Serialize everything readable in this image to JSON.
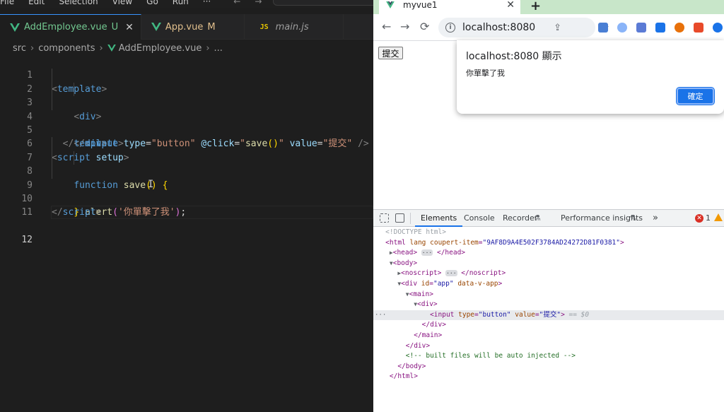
{
  "vscode": {
    "menu": [
      "File",
      "Edit",
      "Selection",
      "View",
      "Go",
      "Run",
      "···"
    ],
    "tabs": [
      {
        "label": "AddEmployee.vue",
        "status": "U",
        "close": "✕"
      },
      {
        "label": "App.vue",
        "status": "M"
      },
      {
        "label": "main.js",
        "icon_text": "JS"
      }
    ],
    "breadcrumb": [
      "src",
      "components",
      "AddEmployee.vue",
      "..."
    ],
    "line_numbers": [
      "1",
      "2",
      "3",
      "4",
      "5",
      "6",
      "7",
      "8",
      "9",
      "10",
      "11",
      "12"
    ],
    "colors": {
      "accent": "#3794ff",
      "vue_green": "#41b883"
    }
  },
  "chrome": {
    "tab_title": "myvue1",
    "tab_close": "✕",
    "new_tab": "+",
    "url": "localhost:8080",
    "page": {
      "submit_button": "提交"
    },
    "alert": {
      "title": "localhost:8080 顯示",
      "message": "你單擊了我",
      "ok_button": "確定"
    },
    "devtools": {
      "tabs": [
        "Elements",
        "Console",
        "Recorder",
        "Performance insights",
        "»"
      ],
      "error_count": "1",
      "selected_suffix": " == $0"
    }
  }
}
